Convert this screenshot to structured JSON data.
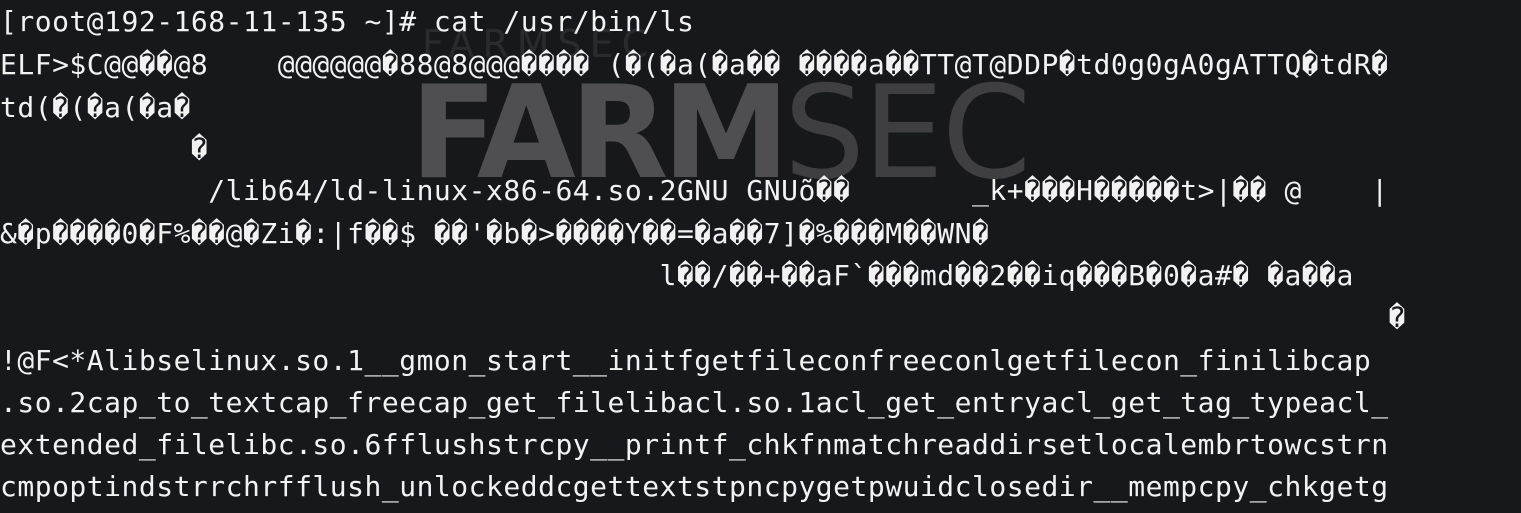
{
  "terminal": {
    "watermark": {
      "top_text": "FARMSEC",
      "main_bold": "FARM",
      "main_light": "SEC"
    },
    "lines": [
      "[root@192-168-11-135 ~]# cat /usr/bin/ls",
      "ELF>$C@@��@8    @@@@@@�88@8@@@���� (�(�a(�a�� ����a��TT@T@DDP�td0g0gA0gATTQ�tdR�",
      "td(�(�a(�a�",
      "           �",
      "            /lib64/ld-linux-x86-64.so.2GNU GNUõ��       _k+���H�����t>|�� @    |",
      "&�p����0�F%��@�Zi�:|f��$ ��'�b�>����Y��=�a��7]�%���M��WN�",
      "                                      l��/��+��aF`���md��2��iq���B�0�a#� �a��a",
      "                                                                                �",
      "!@F<*Alibselinux.so.1__gmon_start__initfgetfileconfreeconlgetfilecon_finilibcap",
      ".so.2cap_to_textcap_freecap_get_filelibacl.so.1acl_get_entryacl_get_tag_typeacl_",
      "extended_filelibc.so.6fflushstrcpy__printf_chkfnmatchreaddirsetlocalembrtowcstrn",
      "cmpoptindstrrchrfflush_unlockeddcgettextstpncpygetpwuidclosedir__mempcpy_chkgetg"
    ]
  }
}
